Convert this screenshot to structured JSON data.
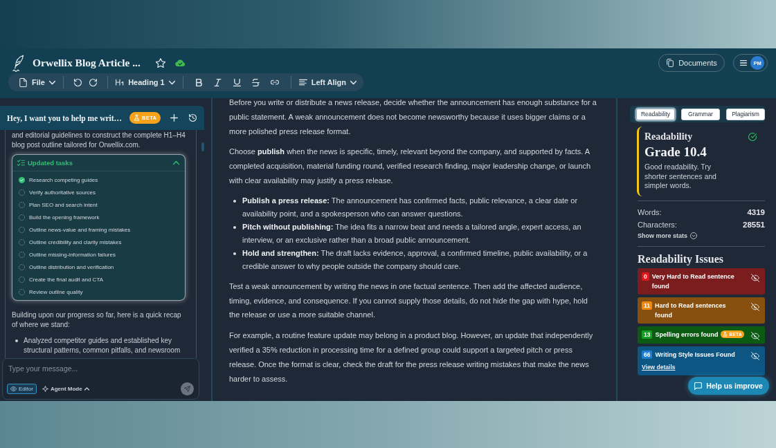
{
  "header": {
    "title": "Orwellix Blog Article ...",
    "starred": false,
    "documents_button": "Documents",
    "avatar_initials": "PM"
  },
  "toolbar": {
    "file_menu": "File",
    "text_style": "Heading 1",
    "alignment": "Left Align"
  },
  "chat": {
    "title": "Hey, I want you to help me writ…",
    "badge": "BETA",
    "intro": "and editorial guidelines to construct the complete H1–H4 blog post outline tailored for Orwellix.com.",
    "task_card": {
      "title": "Updated tasks",
      "expanded": true,
      "tasks": [
        {
          "label": "Research competing guides",
          "checked": true
        },
        {
          "label": "Verify authoritative sources",
          "checked": false
        },
        {
          "label": "Plan SEO and search intent",
          "checked": false
        },
        {
          "label": "Build the opening framework",
          "checked": false
        },
        {
          "label": "Outline news-value and framing mistakes",
          "checked": false
        },
        {
          "label": "Outline credibility and clarity mistakes",
          "checked": false
        },
        {
          "label": "Outline missing-information failures",
          "checked": false
        },
        {
          "label": "Outline distribution and verification",
          "checked": false
        },
        {
          "label": "Create the final audit and CTA",
          "checked": false
        },
        {
          "label": "Review outline quality",
          "checked": false
        }
      ]
    },
    "recap": "Building upon our progress so far, here is a quick recap of where we stand:",
    "bullets": [
      "Analyzed competitor guides and established key structural patterns, common pitfalls, and newsroom"
    ],
    "composer": {
      "placeholder": "Type your message...",
      "editor_button": "Editor",
      "mode_button": "Agent Mode"
    }
  },
  "editor": {
    "blocks": [
      {
        "kind": "paragraph",
        "text": "Before you write or distribute a news release, decide whether the announcement has enough substance for a public statement. A weak announcement does not become newsworthy because it uses bigger claims or a more polished press release format."
      },
      {
        "kind": "paragraph",
        "text": "Choose **publish** when the news is specific, timely, relevant beyond the company, and supported by facts. A completed acquisition, material funding round, verified research finding, major leadership change, or launch with clear availability may justify a press release."
      },
      {
        "kind": "list",
        "items": [
          "**Publish a press release:** The announcement has confirmed facts, public relevance, a clear date or availability point, and a spokesperson who can answer questions.",
          "**Pitch without publishing:** The idea fits a narrow beat and needs a tailored angle, expert access, an interview, or an exclusive rather than a broad public announcement.",
          "**Hold and strengthen:** The draft lacks evidence, approval, a confirmed timeline, public availability, or a credible answer to why people outside the company should care."
        ]
      },
      {
        "kind": "paragraph",
        "text": "Test a weak announcement by writing the news in one factual sentence. Then add the affected audience, timing, evidence, and consequence. If you cannot supply those details, do not hide the gap with hype, hold the release or use a more suitable channel."
      },
      {
        "kind": "paragraph",
        "text": "For example, a routine feature update may belong in a product blog. However, an update that independently verified a 35% reduction in processing time for a defined group could support a targeted pitch or press release. Once the format is clear, check the draft for the press release writing mistakes that make the news harder to assess."
      }
    ]
  },
  "sidebar": {
    "tabs": [
      {
        "label": "Readability",
        "selected": true
      },
      {
        "label": "Grammar",
        "selected": false
      },
      {
        "label": "Plagiarism",
        "selected": false
      }
    ],
    "score": {
      "title": "Readability",
      "grade": "Grade 10.4",
      "summary": "Good readability. Try shorter sentences and simpler words."
    },
    "stats": [
      {
        "label": "Words:",
        "value": "4319"
      },
      {
        "label": "Characters:",
        "value": "28551"
      }
    ],
    "more_stats": "Show more stats",
    "issues_title": "Readability Issues",
    "issues": [
      {
        "kind": "very_hard",
        "color": "#7b1d1f",
        "count": "0",
        "label": "Very Hard to Read sentence found"
      },
      {
        "kind": "hard",
        "color": "#87500f",
        "count": "11",
        "label": "Hard to Read sentences found"
      },
      {
        "kind": "spelling",
        "color": "#0c5b12",
        "count": "13",
        "label": "Spelling errors found",
        "badge": "BETA"
      },
      {
        "kind": "style",
        "color": "#0d5583",
        "count": "66",
        "label": "Writing Style Issues Found",
        "link": "View details"
      }
    ]
  },
  "feedback_button": "Help us improve"
}
